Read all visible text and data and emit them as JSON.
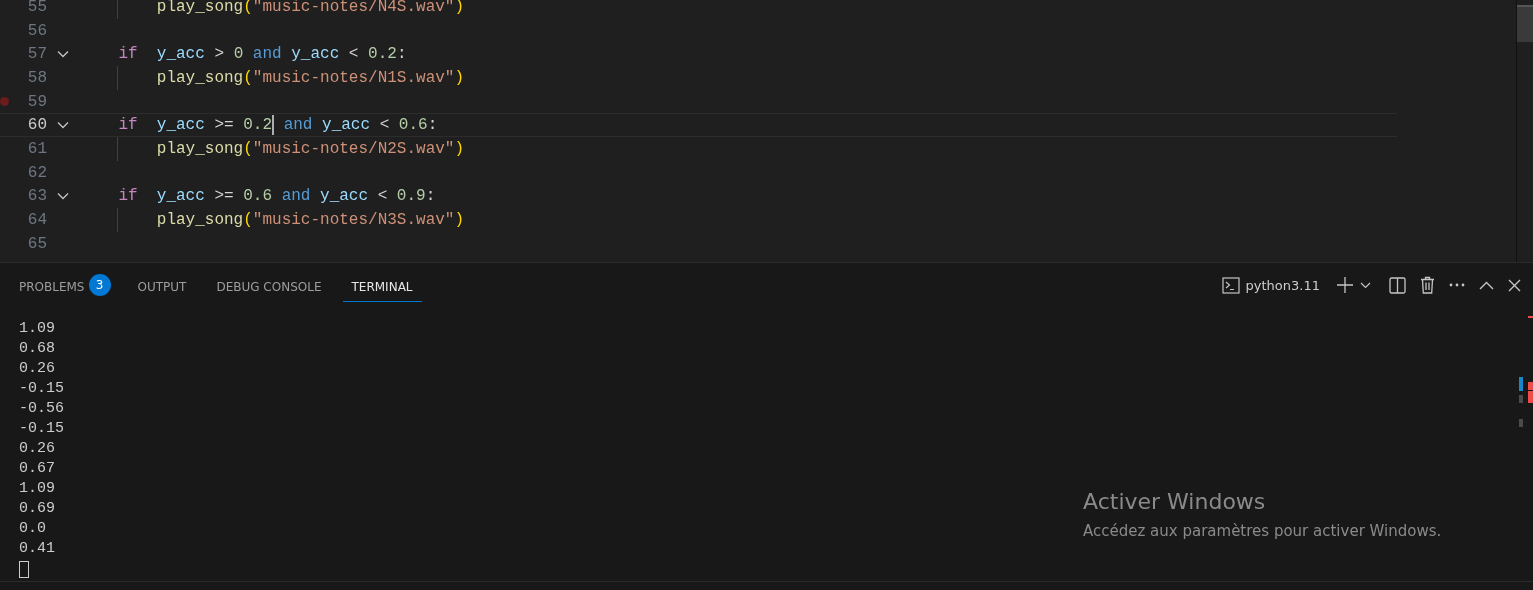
{
  "editor": {
    "lines": [
      {
        "children": [
          {
            "number": "55",
            "fold": false,
            "current": false,
            "breakpoint": false,
            "tokens": [
              {
                "text": "play_song",
                "kind": "func"
              },
              {
                "text": "(",
                "kind": "paren"
              },
              {
                "text": "\"music-notes/N4S.wav\"",
                "kind": "string"
              },
              {
                "text": ")",
                "kind": "paren"
              }
            ]
          }
        ]
      },
      {
        "number": "56",
        "fold": false,
        "current": false,
        "breakpoint": false
      },
      {
        "number": "57",
        "fold": true,
        "current": false,
        "breakpoint": false,
        "tokens": [
          {
            "text": "if",
            "kind": "keyword"
          },
          {
            "text": "  y_acc",
            "kind": "var"
          },
          {
            "text": " > ",
            "kind": "op"
          },
          {
            "text": "0",
            "kind": "number"
          },
          {
            "text": " and",
            "kind": "logic"
          },
          {
            "text": " y_acc",
            "kind": "var"
          },
          {
            "text": " < ",
            "kind": "op"
          },
          {
            "text": "0.2",
            "kind": "number"
          },
          {
            "text": ":",
            "kind": "op"
          }
        ],
        "children": [
          {
            "number": "58",
            "fold": false,
            "current": false,
            "breakpoint": false,
            "tokens": [
              {
                "text": "play_song",
                "kind": "func"
              },
              {
                "text": "(",
                "kind": "paren"
              },
              {
                "text": "\"music-notes/N1S.wav\"",
                "kind": "string"
              },
              {
                "text": ")",
                "kind": "paren"
              }
            ]
          }
        ]
      },
      {
        "number": "59",
        "fold": false,
        "current": false,
        "breakpoint": true
      },
      {
        "number": "60",
        "fold": true,
        "current": true,
        "breakpoint": false,
        "tokens": [
          {
            "text": "if",
            "kind": "keyword"
          },
          {
            "text": "  y_acc",
            "kind": "var"
          },
          {
            "text": " >= ",
            "kind": "op"
          },
          {
            "text": "0.2",
            "kind": "number"
          },
          {
            "kind": "caret"
          },
          {
            "text": " and",
            "kind": "logic"
          },
          {
            "text": " y_acc",
            "kind": "var"
          },
          {
            "text": " < ",
            "kind": "op"
          },
          {
            "text": "0.6",
            "kind": "number"
          },
          {
            "text": ":",
            "kind": "op"
          }
        ],
        "children": [
          {
            "number": "61",
            "fold": false,
            "current": false,
            "breakpoint": false,
            "tokens": [
              {
                "text": "play_song",
                "kind": "func"
              },
              {
                "text": "(",
                "kind": "paren"
              },
              {
                "text": "\"music-notes/N2S.wav\"",
                "kind": "string"
              },
              {
                "text": ")",
                "kind": "paren"
              }
            ]
          }
        ]
      },
      {
        "number": "62",
        "fold": false,
        "current": false,
        "breakpoint": false
      },
      {
        "number": "63",
        "fold": true,
        "current": false,
        "breakpoint": false,
        "tokens": [
          {
            "text": "if",
            "kind": "keyword"
          },
          {
            "text": "  y_acc",
            "kind": "var"
          },
          {
            "text": " >= ",
            "kind": "op"
          },
          {
            "text": "0.6",
            "kind": "number"
          },
          {
            "text": " and",
            "kind": "logic"
          },
          {
            "text": " y_acc",
            "kind": "var"
          },
          {
            "text": " < ",
            "kind": "op"
          },
          {
            "text": "0.9",
            "kind": "number"
          },
          {
            "text": ":",
            "kind": "op"
          }
        ],
        "children": [
          {
            "number": "64",
            "fold": false,
            "current": false,
            "breakpoint": false,
            "tokens": [
              {
                "text": "play_song",
                "kind": "func"
              },
              {
                "text": "(",
                "kind": "paren"
              },
              {
                "text": "\"music-notes/N3S.wav\"",
                "kind": "string"
              },
              {
                "text": ")",
                "kind": "paren"
              }
            ]
          }
        ]
      },
      {
        "number": "65",
        "fold": false,
        "current": false,
        "breakpoint": false
      }
    ]
  },
  "panel": {
    "tabs": [
      {
        "label": "PROBLEMS",
        "badge": "3",
        "selected": false
      },
      {
        "label": "OUTPUT",
        "selected": false
      },
      {
        "label": "DEBUG CONSOLE",
        "selected": false
      },
      {
        "label": "TERMINAL",
        "selected": true
      }
    ],
    "terminal_name": "python3.11",
    "terminal_output": [
      "1.09",
      "0.68",
      "0.26",
      "-0.15",
      "-0.56",
      "-0.15",
      "0.26",
      "0.67",
      "1.09",
      "0.69",
      "0.0",
      "0.41"
    ],
    "activation": {
      "title": "Activer Windows",
      "message": "Accédez aux paramètres pour activer Windows."
    }
  }
}
